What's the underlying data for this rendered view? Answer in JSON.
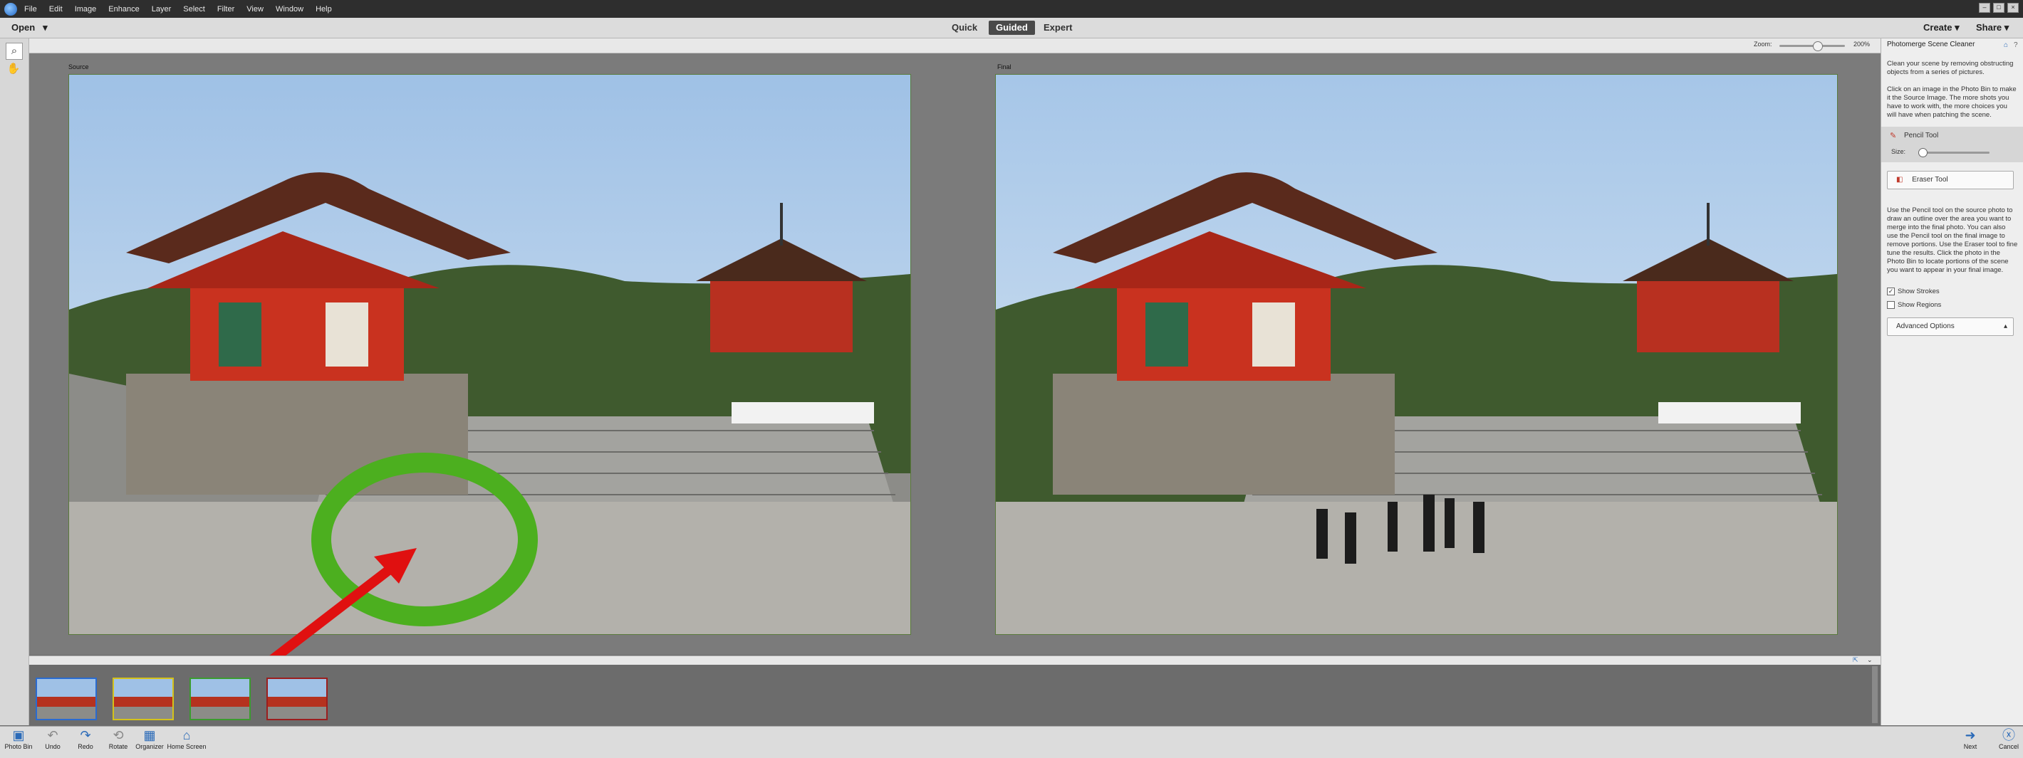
{
  "menubar": {
    "items": [
      "File",
      "Edit",
      "Image",
      "Enhance",
      "Layer",
      "Select",
      "Filter",
      "View",
      "Window",
      "Help"
    ]
  },
  "modebar": {
    "open_label": "Open",
    "modes": [
      "Quick",
      "Guided",
      "Expert"
    ],
    "active_mode": "Guided",
    "create_label": "Create",
    "share_label": "Share"
  },
  "zoom": {
    "label": "Zoom:",
    "value_text": "200%",
    "value_fraction": 0.58
  },
  "canvas": {
    "source_label": "Source",
    "final_label": "Final"
  },
  "panel": {
    "title": "Photomerge Scene Cleaner",
    "intro": "Clean your scene by removing obstructing objects from a series of pictures.",
    "instructions": "Click on an image in the Photo Bin to make it the Source Image. The more shots you have to work with, the more choices you will have when patching the scene.",
    "pencil_label": "Pencil Tool",
    "size_label": "Size:",
    "size_value_fraction": 0.05,
    "eraser_label": "Eraser Tool",
    "help_text": "Use the Pencil tool on the source photo to draw an outline over the area you want to merge into the final photo. You can also use the Pencil tool on the final image to remove portions. Use the Eraser tool to fine tune the results. Click the photo in the Photo Bin to locate portions of the scene you want to appear in your final image.",
    "show_strokes_label": "Show Strokes",
    "show_strokes_checked": true,
    "show_regions_label": "Show Regions",
    "show_regions_checked": false,
    "advanced_label": "Advanced Options"
  },
  "bin": {
    "thumbnail_frame_colors": [
      "#2a6bd0",
      "#d4c21a",
      "#3b9b2f",
      "#9b1e1e"
    ]
  },
  "bottombar": {
    "left_items": [
      "Photo Bin",
      "Undo",
      "Redo",
      "Rotate",
      "Organizer",
      "Home Screen"
    ],
    "next_label": "Next",
    "cancel_label": "Cancel"
  },
  "colors": {
    "annotation_circle": "#4caf1f",
    "annotation_arrow": "#e01010",
    "accent": "#2a6ab8"
  }
}
